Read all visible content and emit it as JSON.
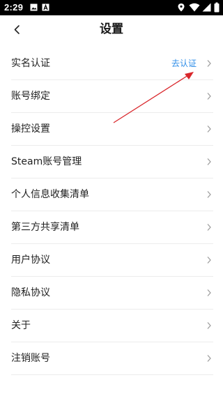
{
  "status_bar": {
    "time": "2:29"
  },
  "header": {
    "title": "设置",
    "back_icon": "chevron-left-icon"
  },
  "menu": {
    "items": [
      {
        "label": "实名认证",
        "value": "去认证"
      },
      {
        "label": "账号绑定"
      },
      {
        "label": "操控设置"
      },
      {
        "label": "Steam账号管理"
      },
      {
        "label": "个人信息收集清单"
      },
      {
        "label": "第三方共享清单"
      },
      {
        "label": "用户协议"
      },
      {
        "label": "隐私协议"
      },
      {
        "label": "关于"
      },
      {
        "label": "注销账号"
      }
    ]
  },
  "colors": {
    "accent": "#2f8ee8",
    "annotation_arrow": "#d9262b"
  }
}
